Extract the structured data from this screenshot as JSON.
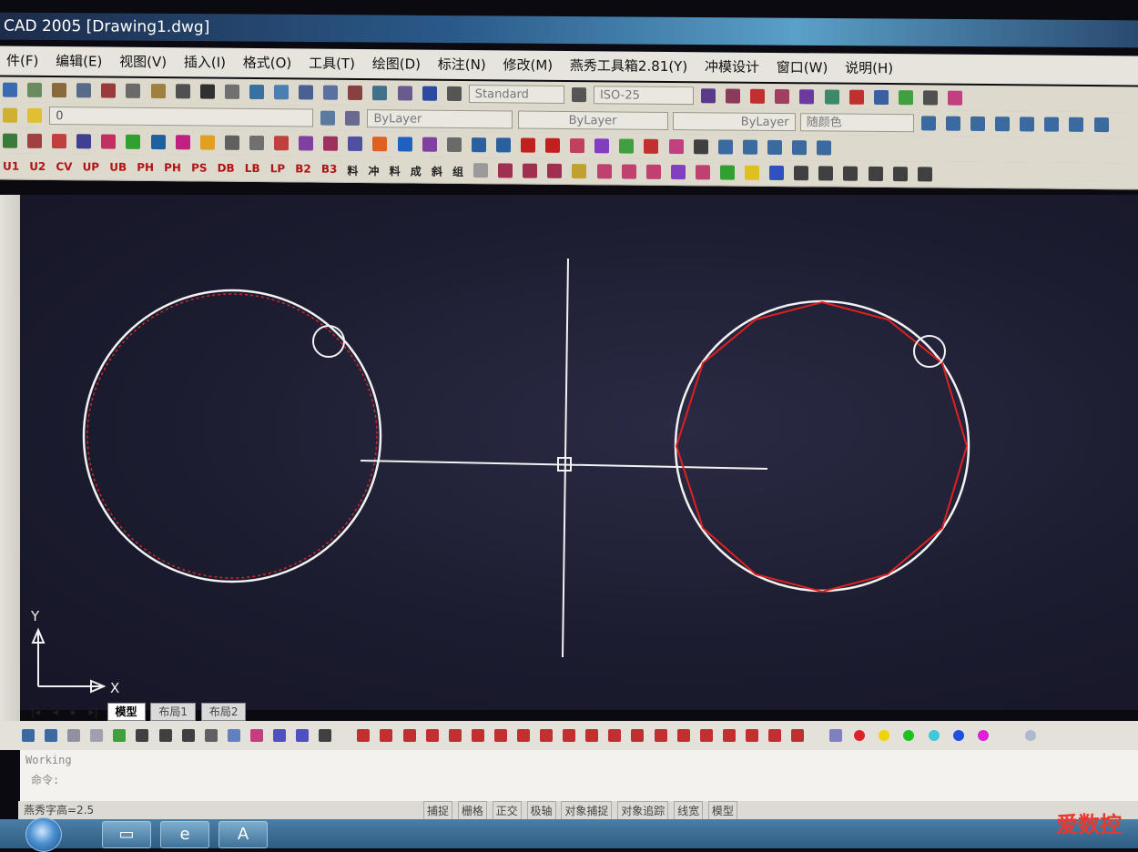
{
  "window": {
    "title": "CAD 2005    [Drawing1.dwg]"
  },
  "menu": [
    {
      "label": "件(F)"
    },
    {
      "label": "编辑(E)"
    },
    {
      "label": "视图(V)"
    },
    {
      "label": "插入(I)"
    },
    {
      "label": "格式(O)"
    },
    {
      "label": "工具(T)"
    },
    {
      "label": "绘图(D)"
    },
    {
      "label": "标注(N)"
    },
    {
      "label": "修改(M)"
    },
    {
      "label": "燕秀工具箱2.81(Y)"
    },
    {
      "label": "冲模设计"
    },
    {
      "label": "窗口(W)"
    },
    {
      "label": "说明(H)"
    }
  ],
  "toolbar": {
    "text_style": "Standard",
    "dim_style": "ISO-25",
    "layer_value": "0",
    "color": "ByLayer",
    "linetype": "ByLayer",
    "lineweight": "ByLayer",
    "plot_style": "随颜色"
  },
  "toolbar_row4_labels": [
    "U1",
    "U2",
    "CV",
    "UP",
    "UB",
    "PH",
    "PH",
    "PS",
    "DB",
    "LB",
    "LP",
    "B2",
    "B3",
    "料",
    "冲",
    "料",
    "成",
    "斜",
    "组"
  ],
  "drawing": {
    "ucs_labels": {
      "x": "X",
      "y": "Y"
    }
  },
  "layout_tabs": [
    {
      "label": "模型",
      "active": true
    },
    {
      "label": "布局1",
      "active": false
    },
    {
      "label": "布局2",
      "active": false
    }
  ],
  "command": {
    "line1": "Working",
    "line2": "命令:"
  },
  "status": {
    "coords": "燕秀字高=2.5",
    "buttons": [
      "捕捉",
      "栅格",
      "正交",
      "极轴",
      "对象捕捉",
      "对象追踪",
      "线宽",
      "模型"
    ]
  },
  "colors": {
    "palette": [
      "#e0202a",
      "#f2d200",
      "#1ec21e",
      "#40c8d8",
      "#2050e0",
      "#e020d8",
      "#b0b8d0"
    ]
  },
  "watermark": "爱数控"
}
